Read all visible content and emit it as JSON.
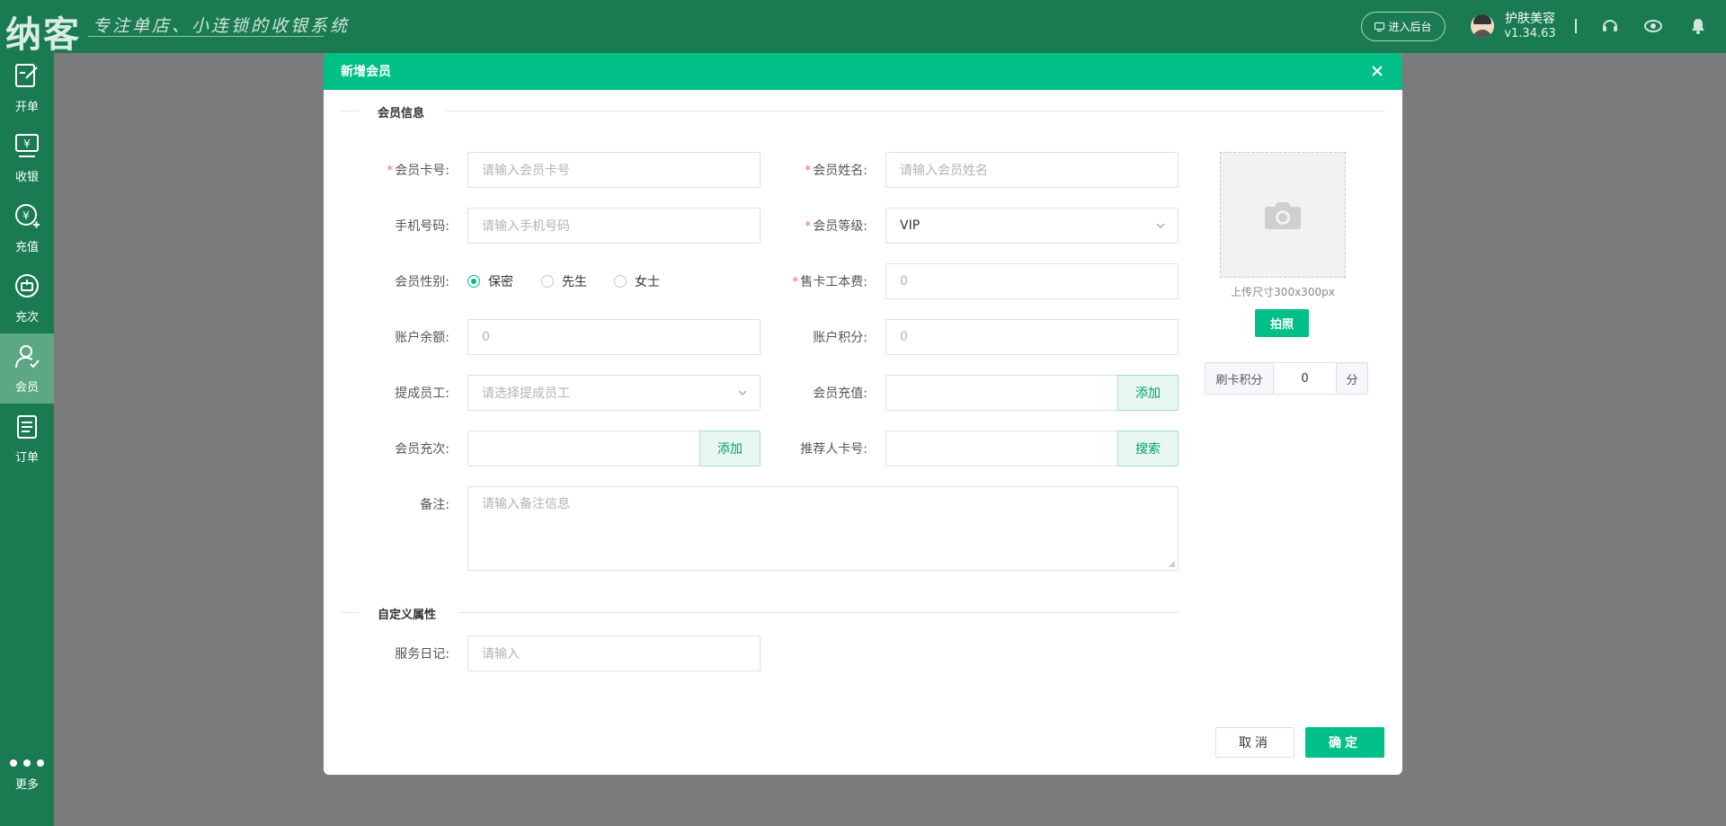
{
  "topbar": {
    "logo": "纳客",
    "slogan": "专注单店、小连锁的收银系统",
    "backend_button": "进入后台",
    "shop_name": "护肤美容",
    "version": "v1.34.63",
    "icons": [
      "headset-icon",
      "eye-icon",
      "bell-icon"
    ]
  },
  "sidebar": {
    "items": [
      {
        "label": "开单",
        "icon": "edit-icon"
      },
      {
        "label": "收银",
        "icon": "cashier-icon"
      },
      {
        "label": "充值",
        "icon": "recharge-icon"
      },
      {
        "label": "充次",
        "icon": "count-icon"
      },
      {
        "label": "会员",
        "icon": "member-icon"
      },
      {
        "label": "订单",
        "icon": "order-icon"
      }
    ],
    "active": "会员",
    "more": "更多"
  },
  "dialog": {
    "title": "新增会员",
    "section_info": "会员信息",
    "section_custom": "自定义属性",
    "fields": {
      "card_no": {
        "label": "会员卡号:",
        "placeholder": "请输入会员卡号",
        "required": true
      },
      "name": {
        "label": "会员姓名:",
        "placeholder": "请输入会员姓名",
        "required": true
      },
      "phone": {
        "label": "手机号码:",
        "placeholder": "请输入手机号码"
      },
      "level": {
        "label": "会员等级:",
        "value": "VIP",
        "required": true
      },
      "gender": {
        "label": "会员性别:",
        "options": [
          "保密",
          "先生",
          "女士"
        ],
        "selected": "保密"
      },
      "card_fee": {
        "label": "售卡工本费:",
        "value": "0",
        "required": true
      },
      "balance": {
        "label": "账户余额:",
        "value": "0"
      },
      "points": {
        "label": "账户积分:",
        "value": "0"
      },
      "staff": {
        "label": "提成员工:",
        "placeholder": "请选择提成员工"
      },
      "recharge": {
        "label": "会员充值:",
        "button": "添加"
      },
      "count_recharge": {
        "label": "会员充次:",
        "button": "添加"
      },
      "referrer": {
        "label": "推荐人卡号:",
        "button": "搜索"
      },
      "remark": {
        "label": "备注:",
        "placeholder": "请输入备注信息"
      },
      "service_diary": {
        "label": "服务日记:",
        "placeholder": "请输入"
      }
    },
    "upload": {
      "hint": "上传尺寸300x300px",
      "photo_button": "拍照"
    },
    "swipe_points": {
      "prefix": "刷卡积分",
      "value": "0",
      "suffix": "分"
    },
    "buttons": {
      "cancel": "取消",
      "ok": "确定"
    }
  },
  "colors": {
    "topbar": "#1a7a52",
    "accent": "#00c087",
    "required": "#f56c6c"
  }
}
